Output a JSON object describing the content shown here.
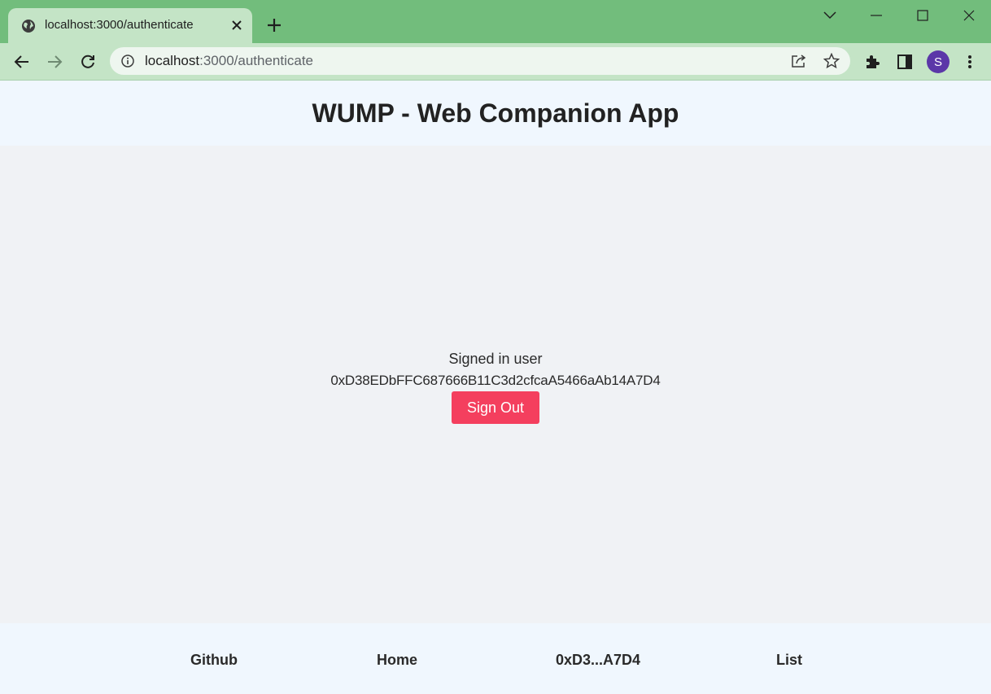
{
  "browser": {
    "tab_title": "localhost:3000/authenticate",
    "url_host": "localhost",
    "url_path": ":3000/authenticate",
    "profile_initial": "S",
    "accent": "#72bd7c",
    "toolbar_color": "#c4e4c6"
  },
  "header": {
    "title": "WUMP - Web Companion App"
  },
  "main": {
    "signed_label": "Signed in user",
    "address": "0xD38EDbFFC687666B11C3d2cfcaA5466aAb14A7D4",
    "signout_label": "Sign Out",
    "button_color": "#f43f5e"
  },
  "footer": {
    "links": [
      "Github",
      "Home",
      "0xD3...A7D4",
      "List"
    ]
  }
}
